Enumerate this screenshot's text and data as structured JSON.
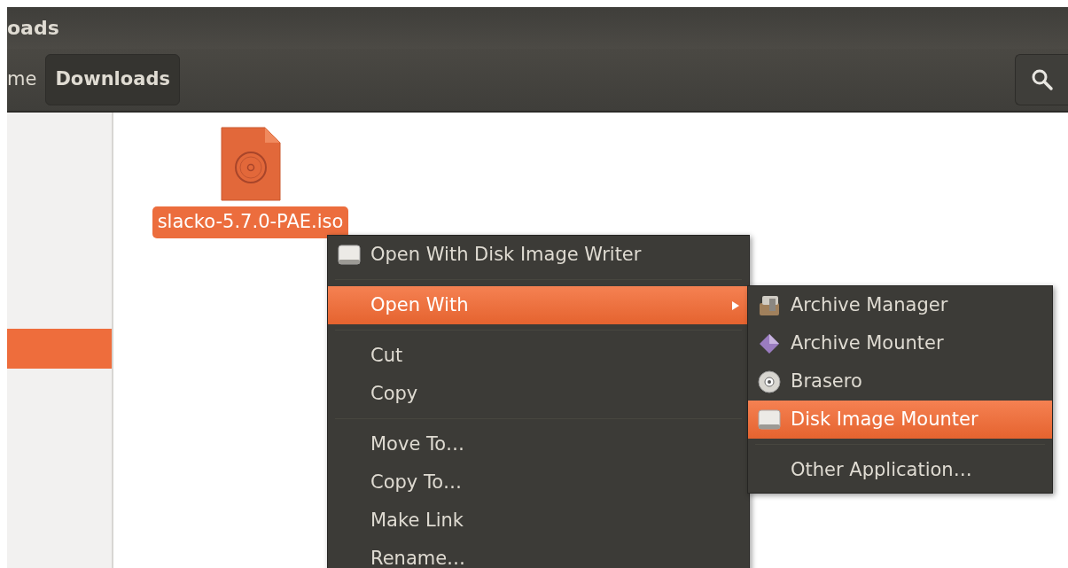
{
  "window": {
    "title": "oads"
  },
  "path_bar": [
    {
      "label": "me",
      "selected": false
    },
    {
      "label": "Downloads",
      "selected": true
    }
  ],
  "sidebar": {
    "items": [
      {
        "selected": true
      }
    ]
  },
  "files": [
    {
      "name": "slacko-5.7.0-PAE.iso",
      "selected": true
    }
  ],
  "context_menu": {
    "items": [
      {
        "kind": "app",
        "label": "Open With Disk Image Writer",
        "selected": false
      },
      {
        "kind": "separator"
      },
      {
        "kind": "submenu",
        "label": "Open With",
        "selected": true
      },
      {
        "kind": "separator"
      },
      {
        "kind": "plain",
        "label": "Cut",
        "selected": false
      },
      {
        "kind": "plain",
        "label": "Copy",
        "selected": false
      },
      {
        "kind": "separator"
      },
      {
        "kind": "plain",
        "label": "Move To…",
        "selected": false
      },
      {
        "kind": "plain",
        "label": "Copy To…",
        "selected": false
      },
      {
        "kind": "plain",
        "label": "Make Link",
        "selected": false
      },
      {
        "kind": "plain",
        "label": "Rename…",
        "selected": false
      }
    ]
  },
  "submenu": {
    "items": [
      {
        "kind": "app",
        "label": "Archive Manager",
        "selected": false
      },
      {
        "kind": "app",
        "label": "Archive Mounter",
        "selected": false
      },
      {
        "kind": "app",
        "label": "Brasero",
        "selected": false
      },
      {
        "kind": "app",
        "label": "Disk Image Mounter",
        "selected": true
      },
      {
        "kind": "separator"
      },
      {
        "kind": "plain",
        "label": "Other Application…",
        "selected": false
      }
    ]
  }
}
